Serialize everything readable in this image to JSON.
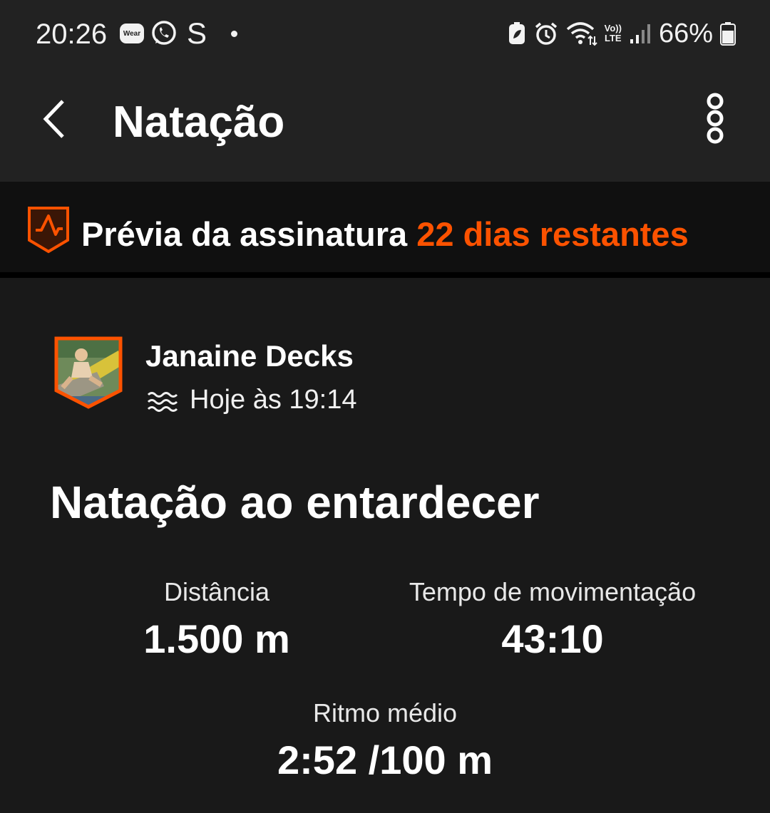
{
  "status_bar": {
    "time": "20:26",
    "wear_label": "Wear",
    "s_label": "S",
    "lte_label_top": "Vo))",
    "lte_label_bottom": "LTE",
    "battery_percent": "66%",
    "icons": [
      "wear-icon",
      "whatsapp-icon",
      "s-app-icon",
      "notification-dot-icon",
      "battery-saver-icon",
      "alarm-icon",
      "wifi-icon",
      "volte-icon",
      "signal-icon",
      "battery-icon"
    ]
  },
  "header": {
    "title": "Natação",
    "back_icon": "chevron-left-icon",
    "more_icon": "more-vertical-icon"
  },
  "subscription_banner": {
    "label": "Prévia da assinatura",
    "days_remaining": "22 dias restantes",
    "accent_color": "#fc5200",
    "icon": "strava-subscription-icon"
  },
  "activity": {
    "athlete_name": "Janaine Decks",
    "sport_icon": "swim-icon",
    "timestamp": "Hoje às 19:14",
    "title": "Natação ao entardecer",
    "stats": {
      "distance": {
        "label": "Distância",
        "value": "1.500 m"
      },
      "moving_time": {
        "label": "Tempo de movimentação",
        "value": "43:10"
      },
      "avg_pace": {
        "label": "Ritmo médio",
        "value": "2:52 /100 m"
      }
    }
  }
}
